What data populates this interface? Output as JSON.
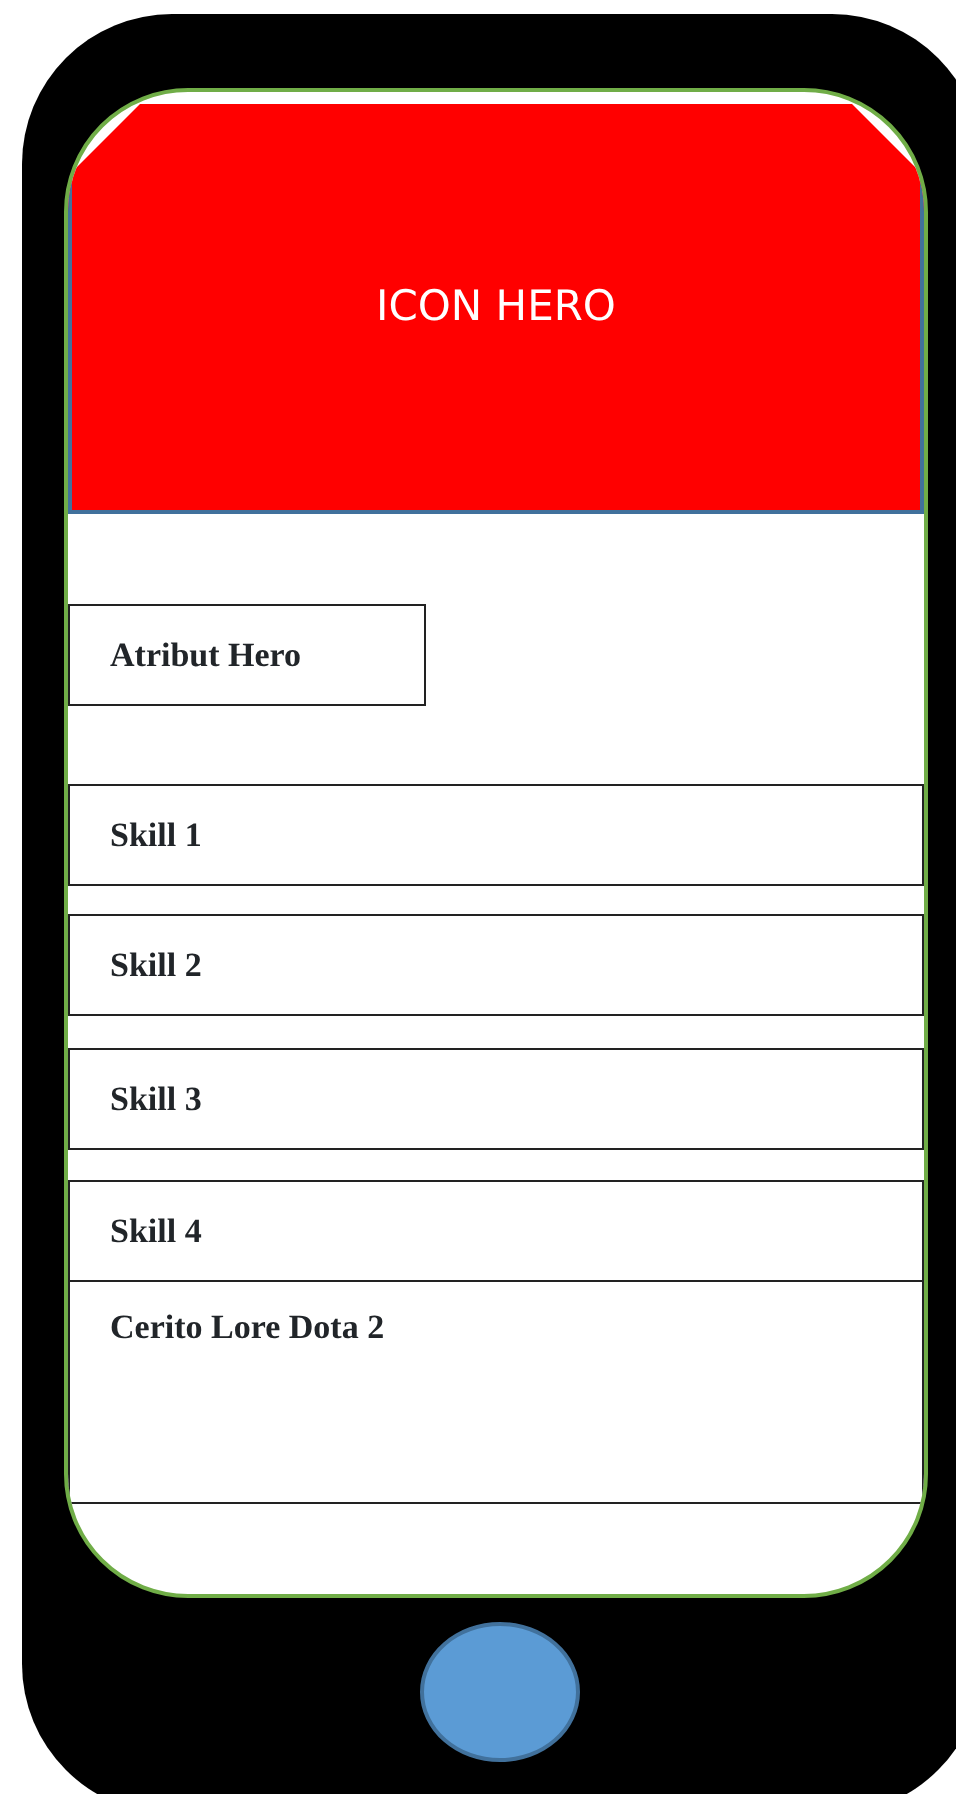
{
  "header": {
    "title": "ICON HERO"
  },
  "attribute": {
    "label": "Atribut Hero"
  },
  "skills": [
    {
      "label": "Skill 1"
    },
    {
      "label": "Skill 2"
    },
    {
      "label": "Skill 3"
    },
    {
      "label": "Skill 4"
    }
  ],
  "lore": {
    "title": "Cerito Lore Dota 2"
  }
}
